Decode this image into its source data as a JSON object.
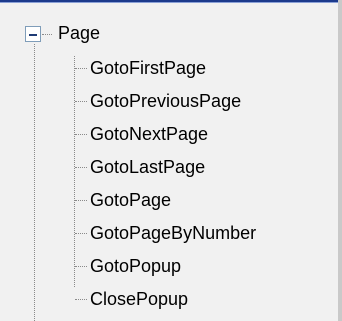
{
  "tree": {
    "root": {
      "label": "Page",
      "expanded": true,
      "expander_symbol": "minus"
    },
    "children": [
      {
        "label": "GotoFirstPage"
      },
      {
        "label": "GotoPreviousPage"
      },
      {
        "label": "GotoNextPage"
      },
      {
        "label": "GotoLastPage"
      },
      {
        "label": "GotoPage"
      },
      {
        "label": "GotoPageByNumber"
      },
      {
        "label": "GotoPopup"
      },
      {
        "label": "ClosePopup"
      }
    ]
  }
}
